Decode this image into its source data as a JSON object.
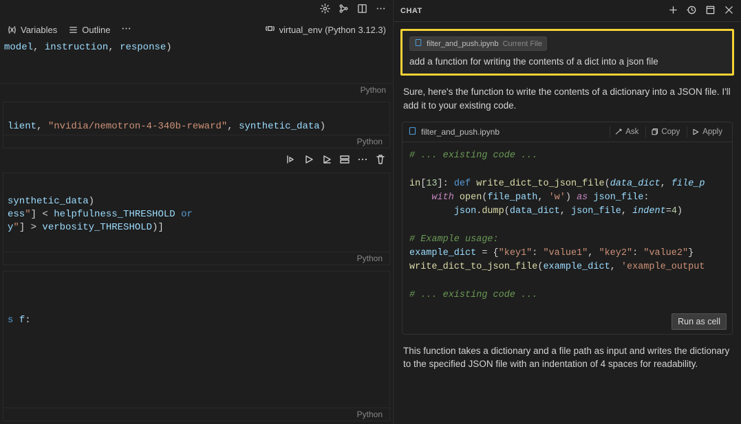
{
  "editor": {
    "kernel_label": "virtual_env (Python 3.12.3)",
    "variables_label": "Variables",
    "outline_label": "Outline",
    "lang_label": "Python",
    "cells": {
      "c1": "model, instruction, response)",
      "c2": "lient, \"nvidia/nemotron-4-340b-reward\", synthetic_data)",
      "c3_line1": "synthetic_data)",
      "c3_line2": "ess\"] < helpfulness_THRESHOLD or",
      "c3_line3": "y\"] > verbosity_THRESHOLD)]",
      "c4": "s f:"
    }
  },
  "chat": {
    "title": "CHAT",
    "context_file": "filter_and_push.ipynb",
    "context_scope": "Current File",
    "user_prompt": "add a function for writing the contents of a dict into a json file",
    "assistant_intro": "Sure, here's the function to write the contents of a dictionary into a JSON file. I'll add it to your existing code.",
    "code_file": "filter_and_push.ipynb",
    "btn_ask": "Ask",
    "btn_copy": "Copy",
    "btn_apply": "Apply",
    "code_body": "# ... existing code ...\n\nin[13]: def write_dict_to_json_file(data_dict, file_p\n    with open(file_path, 'w') as json_file:\n        json.dump(data_dict, json_file, indent=4)\n\n# Example usage:\nexample_dict = {\"key1\": \"value1\", \"key2\": \"value2\"}\nwrite_dict_to_json_file(example_dict, 'example_output\n\n# ... existing code ...",
    "run_cell": "Run as cell",
    "assistant_outro": "This function takes a dictionary and a file path as input and writes the dictionary to the specified JSON file with an indentation of 4 spaces for readability."
  }
}
